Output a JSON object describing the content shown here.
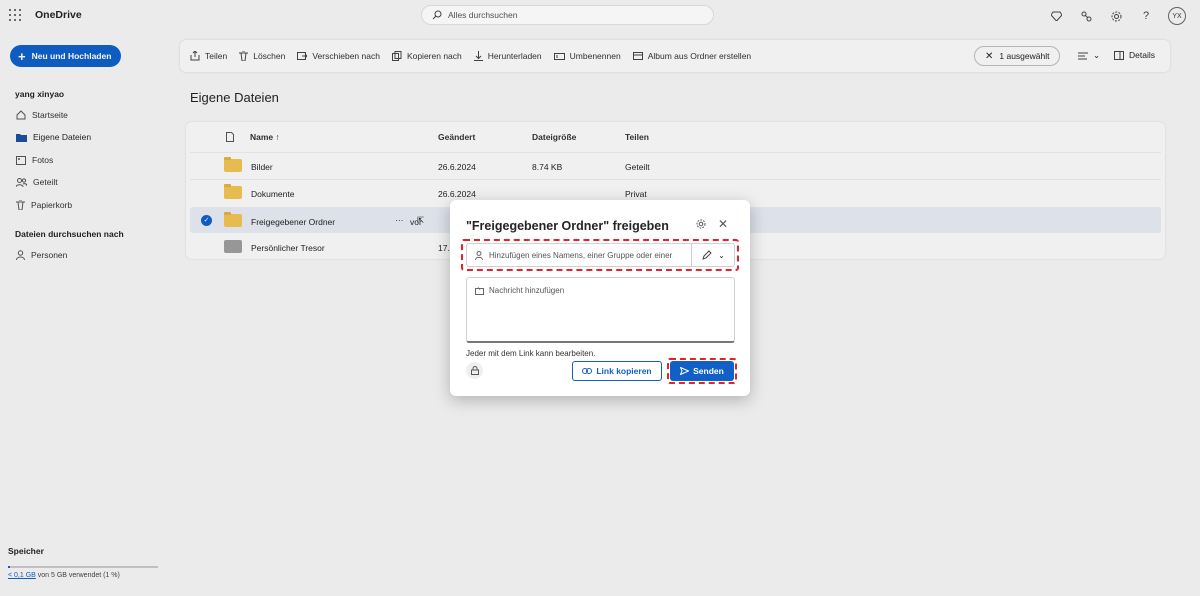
{
  "app": {
    "title": "OneDrive"
  },
  "search": {
    "placeholder": "Alles durchsuchen"
  },
  "user": {
    "initials": "YX",
    "name": "yang xinyao"
  },
  "sidebar": {
    "new_button": "Neu und Hochladen",
    "items": [
      {
        "label": "Startseite",
        "icon": "home-icon"
      },
      {
        "label": "Eigene Dateien",
        "icon": "folder-icon"
      },
      {
        "label": "Fotos",
        "icon": "photo-icon"
      },
      {
        "label": "Geteilt",
        "icon": "people-icon"
      },
      {
        "label": "Papierkorb",
        "icon": "trash-icon"
      }
    ],
    "browse_section": "Dateien durchsuchen nach",
    "browse_items": [
      {
        "label": "Personen",
        "icon": "person-icon"
      }
    ],
    "storage": {
      "title": "Speicher",
      "used": "< 0,1 GB",
      "rest": " von 5 GB verwendet (1 %)",
      "fraction": 0.01
    }
  },
  "toolbar": {
    "commands": [
      {
        "label": "Teilen",
        "icon": "share-icon"
      },
      {
        "label": "Löschen",
        "icon": "trash-icon"
      },
      {
        "label": "Verschieben nach",
        "icon": "move-icon"
      },
      {
        "label": "Kopieren nach",
        "icon": "copy-icon"
      },
      {
        "label": "Herunterladen",
        "icon": "download-icon"
      },
      {
        "label": "Umbenennen",
        "icon": "rename-icon"
      },
      {
        "label": "Album aus Ordner erstellen",
        "icon": "album-icon"
      }
    ],
    "selected": "1 ausgewählt",
    "details": "Details"
  },
  "main": {
    "title": "Eigene Dateien",
    "columns": {
      "name": "Name ↑",
      "modified": "Geändert",
      "size": "Dateigröße",
      "sharing": "Teilen"
    },
    "rows": [
      {
        "name": "Bilder",
        "modified": "26.6.2024",
        "size": "8.74 KB",
        "sharing": "Geteilt"
      },
      {
        "name": "Dokumente",
        "modified": "26.6.2024",
        "size": "",
        "sharing": "Privat"
      },
      {
        "name": "Freigegebener Ordner",
        "modified": "vor",
        "size": "",
        "sharing": ""
      },
      {
        "name": "Persönlicher Tresor",
        "modified": "17.",
        "size": "",
        "sharing": ""
      }
    ]
  },
  "dialog": {
    "title": "\"Freigegebener Ordner\" freigeben",
    "people_placeholder": "Hinzufügen eines Namens, einer Gruppe oder einer",
    "message_placeholder": "Nachricht hinzufügen",
    "link_info": "Jeder mit dem Link kann bearbeiten.",
    "copy_link": "Link kopieren",
    "send": "Senden"
  },
  "colors": {
    "accent": "#1060c8",
    "highlight": "#e0242c",
    "folder": "#f0c354"
  }
}
